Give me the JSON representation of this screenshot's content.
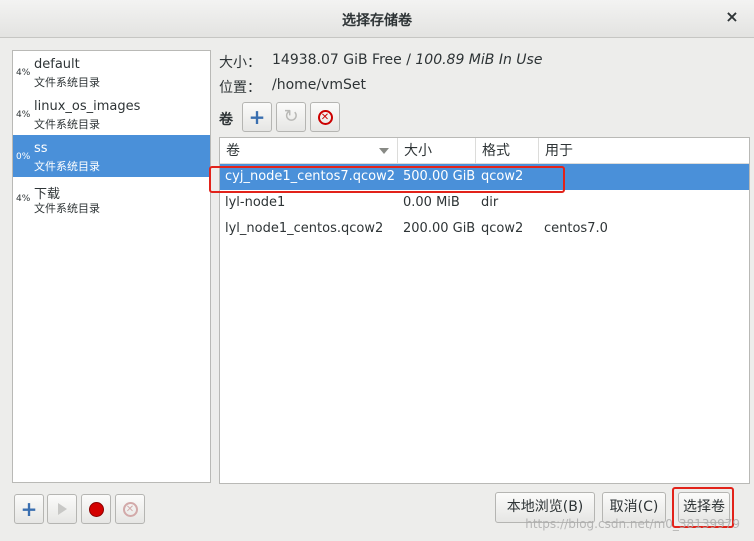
{
  "window": {
    "title": "选择存储卷"
  },
  "pools": [
    {
      "usage": "4%",
      "name": "default",
      "type": "文件系统目录",
      "selected": false
    },
    {
      "usage": "4%",
      "name": "linux_os_images",
      "type": "文件系统目录",
      "selected": false
    },
    {
      "usage": "0%",
      "name": "ss",
      "type": "文件系统目录",
      "selected": true
    },
    {
      "usage": "4%",
      "name": "下载",
      "type": "文件系统目录",
      "selected": false
    }
  ],
  "info": {
    "size_label": "大小：",
    "size_free": "14938.07 GiB Free / ",
    "size_in_use": "100.89 MiB In Use",
    "location_label": "位置：",
    "location_value": "/home/vmSet",
    "volumes_label": "卷"
  },
  "table": {
    "headers": [
      "卷",
      "大小",
      "格式",
      "用于"
    ],
    "rows": [
      {
        "name": "cyj_node1_centos7.qcow2",
        "size": "500.00 GiB",
        "format": "qcow2",
        "used_by": "",
        "selected": true
      },
      {
        "name": "lyl-node1",
        "size": "0.00 MiB",
        "format": "dir",
        "used_by": "",
        "selected": false
      },
      {
        "name": "lyl_node1_centos.qcow2",
        "size": "200.00 GiB",
        "format": "qcow2",
        "used_by": "centos7.0",
        "selected": false
      }
    ]
  },
  "buttons": {
    "browse_local": "本地浏览(B)",
    "cancel": "取消(C)",
    "choose_volume": "选择卷"
  },
  "icons": {
    "add": "+",
    "refresh": "↻",
    "delete": "✕",
    "close": "×"
  },
  "watermark": "https://blog.csdn.net/m0_38139979",
  "colors": {
    "selection": "#4a90d9",
    "highlight": "#e2231a"
  }
}
